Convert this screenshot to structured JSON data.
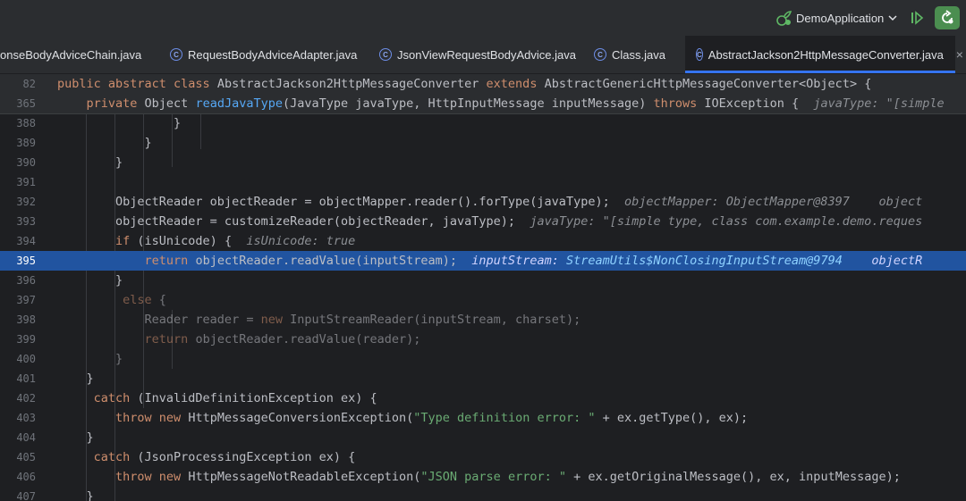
{
  "run": {
    "config_name": "DemoApplication"
  },
  "tabs": [
    {
      "label": "onseBodyAdviceChain.java",
      "active": false,
      "has_icon": false
    },
    {
      "label": "RequestBodyAdviceAdapter.java",
      "active": false,
      "has_icon": true
    },
    {
      "label": "JsonViewRequestBodyAdvice.java",
      "active": false,
      "has_icon": true
    },
    {
      "label": "Class.java",
      "active": false,
      "has_icon": true
    },
    {
      "label": "AbstractJackson2HttpMessageConverter.java",
      "active": true,
      "has_icon": true
    }
  ],
  "tab_close_glyph": "×",
  "class_icon_letter": "C",
  "colors": {
    "accent": "#3574f0",
    "highlight_line": "#2154a0",
    "keyword": "#cf8e6d",
    "function": "#56a8f5",
    "string": "#6aab73",
    "run_icon": "#5fb865"
  },
  "sticky": [
    {
      "num": "82",
      "parts": [
        [
          "kw",
          "public abstract class "
        ],
        [
          "",
          "AbstractJackson2HttpMessageConverter "
        ],
        [
          "kw",
          "extends "
        ],
        [
          "",
          "AbstractGenericHttpMessageConverter<Object> {"
        ]
      ]
    },
    {
      "num": "365",
      "parts": [
        [
          "kw",
          "    private "
        ],
        [
          "",
          "Object "
        ],
        [
          "fn",
          "readJavaType"
        ],
        [
          "",
          "(JavaType javaType, HttpInputMessage inputMessage) "
        ],
        [
          "kw",
          "throws "
        ],
        [
          "",
          "IOException {  "
        ],
        [
          "hint",
          "javaType: \"[simple "
        ]
      ]
    }
  ],
  "lines": [
    {
      "num": "388",
      "parts": [
        [
          "",
          "                }"
        ]
      ]
    },
    {
      "num": "389",
      "parts": [
        [
          "",
          "            }"
        ]
      ]
    },
    {
      "num": "390",
      "parts": [
        [
          "",
          "        }"
        ]
      ]
    },
    {
      "num": "391",
      "parts": [
        [
          "",
          ""
        ]
      ]
    },
    {
      "num": "392",
      "parts": [
        [
          "",
          "        ObjectReader objectReader = objectMapper.reader().forType(javaType);  "
        ],
        [
          "hint",
          "objectMapper: ObjectMapper@8397    object"
        ]
      ]
    },
    {
      "num": "393",
      "parts": [
        [
          "",
          "        objectReader = customizeReader(objectReader, javaType);  "
        ],
        [
          "hint",
          "javaType: \"[simple type, class com.example.demo.reques"
        ]
      ]
    },
    {
      "num": "394",
      "parts": [
        [
          "kw",
          "        if "
        ],
        [
          "",
          "(isUnicode) {  "
        ],
        [
          "hint",
          "isUnicode: true"
        ]
      ]
    },
    {
      "num": "395",
      "highlight": true,
      "parts": [
        [
          "kw",
          "            return "
        ],
        [
          "",
          "objectReader.readValue(inputStream);  "
        ],
        [
          "hint",
          "inputStream: "
        ],
        [
          "hintval",
          "StreamUtils$NonClosingInputStream@9794"
        ],
        [
          "hint",
          "    objectR"
        ]
      ]
    },
    {
      "num": "396",
      "parts": [
        [
          "",
          "        }"
        ]
      ]
    },
    {
      "num": "397",
      "dim": true,
      "parts": [
        [
          "kw",
          "         else "
        ],
        [
          "",
          "{"
        ]
      ]
    },
    {
      "num": "398",
      "dim": true,
      "parts": [
        [
          "",
          "            Reader reader = "
        ],
        [
          "kw",
          "new "
        ],
        [
          "",
          "InputStreamReader(inputStream, charset);"
        ]
      ]
    },
    {
      "num": "399",
      "dim": true,
      "parts": [
        [
          "kw",
          "            return "
        ],
        [
          "",
          "objectReader.readValue(reader);"
        ]
      ]
    },
    {
      "num": "400",
      "dim": true,
      "parts": [
        [
          "",
          "        }"
        ]
      ]
    },
    {
      "num": "401",
      "parts": [
        [
          "",
          "    }"
        ]
      ]
    },
    {
      "num": "402",
      "parts": [
        [
          "kw",
          "     catch "
        ],
        [
          "",
          "(InvalidDefinitionException ex) {"
        ]
      ]
    },
    {
      "num": "403",
      "parts": [
        [
          "kw",
          "        throw new "
        ],
        [
          "",
          "HttpMessageConversionException("
        ],
        [
          "str",
          "\"Type definition error: \""
        ],
        [
          "",
          " + ex.getType(), ex);"
        ]
      ]
    },
    {
      "num": "404",
      "parts": [
        [
          "",
          "    }"
        ]
      ]
    },
    {
      "num": "405",
      "parts": [
        [
          "kw",
          "     catch "
        ],
        [
          "",
          "(JsonProcessingException ex) {"
        ]
      ]
    },
    {
      "num": "406",
      "parts": [
        [
          "kw",
          "        throw new "
        ],
        [
          "",
          "HttpMessageNotReadableException("
        ],
        [
          "str",
          "\"JSON parse error: \""
        ],
        [
          "",
          " + ex.getOriginalMessage(), ex, inputMessage);"
        ]
      ]
    },
    {
      "num": "407",
      "parts": [
        [
          "",
          "    }"
        ]
      ]
    }
  ]
}
